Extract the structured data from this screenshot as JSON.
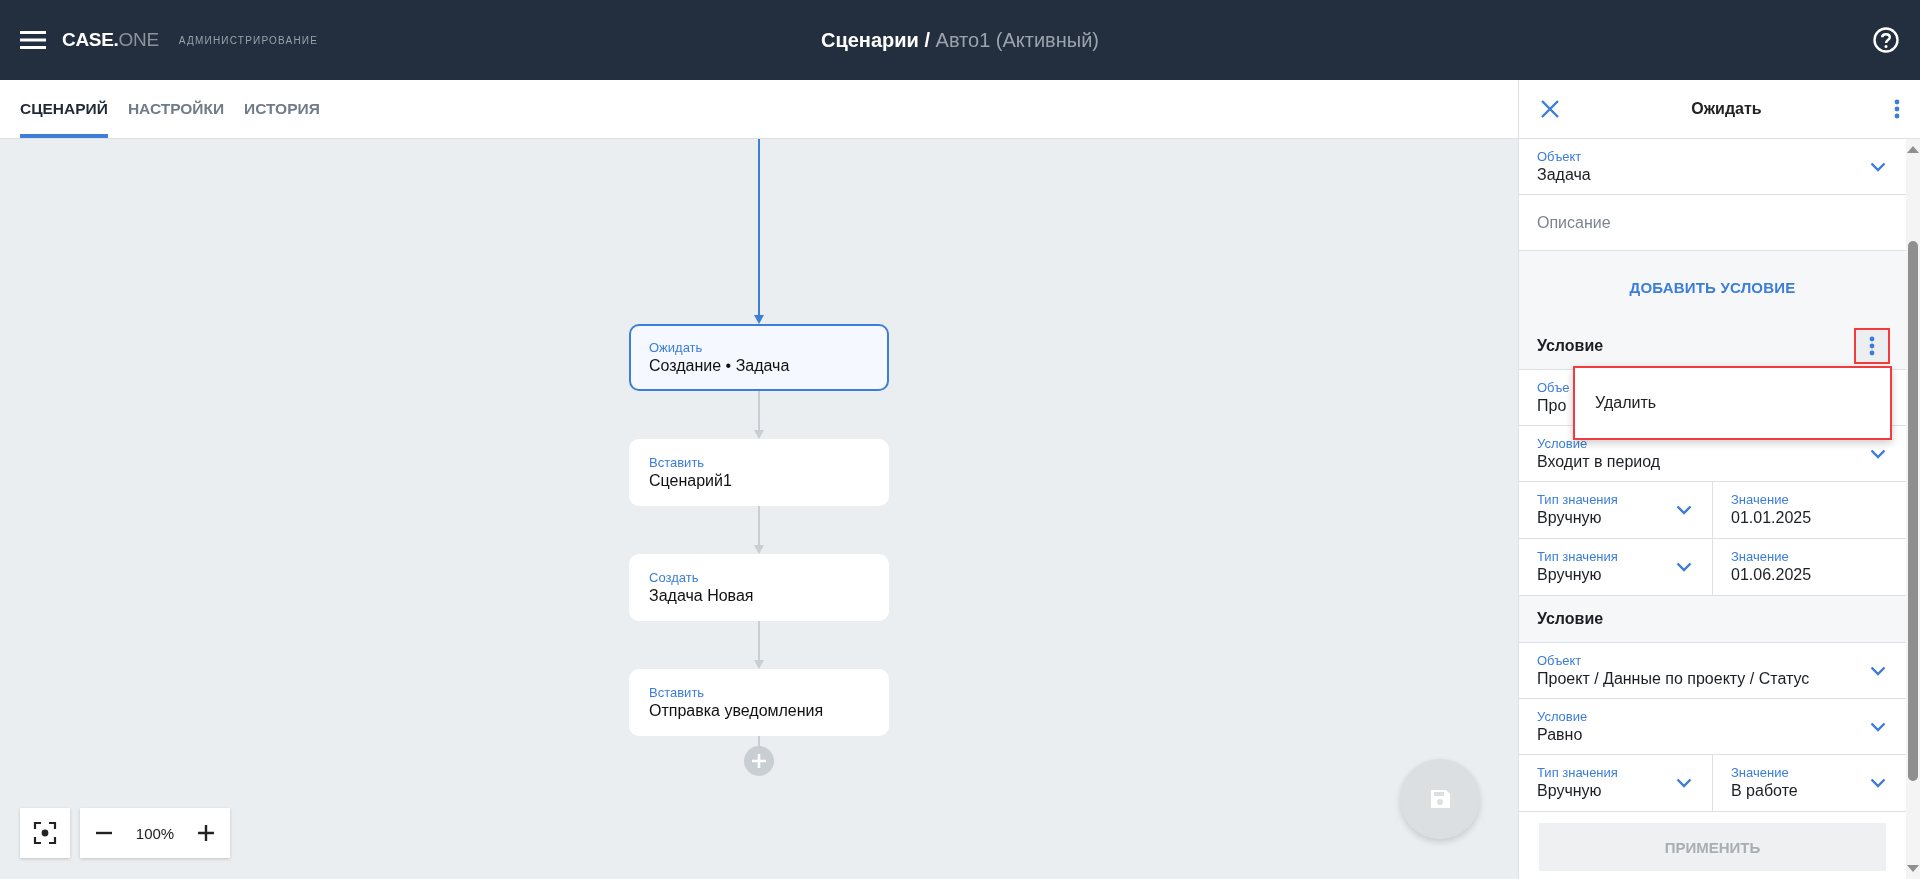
{
  "header": {
    "logo": "CASE.",
    "logo_suffix": "ONE",
    "section": "АДМИНИСТРИРОВАНИЕ",
    "title": "Сценарии /",
    "subtitle": "Авто1 (Активный)"
  },
  "tabs": [
    {
      "label": "СЦЕНАРИЙ",
      "selected": true
    },
    {
      "label": "НАСТРОЙКИ",
      "selected": false
    },
    {
      "label": "ИСТОРИЯ",
      "selected": false
    }
  ],
  "canvas": {
    "nodes": [
      {
        "type": "Ожидать",
        "text": "Создание • Задача",
        "selected": true
      },
      {
        "type": "Вставить",
        "text": "Сценарий1",
        "selected": false
      },
      {
        "type": "Создать",
        "text": "Задача Новая",
        "selected": false
      },
      {
        "type": "Вставить",
        "text": "Отправка уведомления",
        "selected": false
      }
    ],
    "zoom": "100%"
  },
  "panel": {
    "title": "Ожидать",
    "items": [
      {
        "kind": "select",
        "label": "Объект",
        "value": "Задача"
      },
      {
        "kind": "input",
        "placeholder": "Описание"
      },
      {
        "kind": "action",
        "label": "ДОБАВИТЬ УСЛОВИЕ"
      },
      {
        "kind": "section",
        "title": "Условие",
        "menu": {
          "items": [
            "Удалить"
          ]
        }
      },
      {
        "kind": "select",
        "label": "Объе",
        "value": "Про"
      },
      {
        "kind": "select",
        "label": "Условие",
        "value": "Входит в период"
      },
      {
        "kind": "pair",
        "fields": [
          {
            "kind": "select",
            "label": "Тип значения",
            "value": "Вручную"
          },
          {
            "kind": "input",
            "label": "Значение",
            "value": "01.01.2025"
          }
        ]
      },
      {
        "kind": "pair",
        "fields": [
          {
            "kind": "select",
            "label": "Тип значения",
            "value": "Вручную"
          },
          {
            "kind": "input",
            "label": "Значение",
            "value": "01.06.2025"
          }
        ]
      },
      {
        "kind": "section",
        "title": "Условие"
      },
      {
        "kind": "select",
        "label": "Объект",
        "value": "Проект / Данные по проекту / Статус"
      },
      {
        "kind": "select",
        "label": "Условие",
        "value": "Равно"
      },
      {
        "kind": "pair",
        "fields": [
          {
            "kind": "select",
            "label": "Тип значения",
            "value": "Вручную"
          },
          {
            "kind": "select",
            "label": "Значение",
            "value": "В работе"
          }
        ]
      }
    ],
    "apply": {
      "label": "ПРИМЕНИТЬ",
      "disabled": true
    }
  }
}
